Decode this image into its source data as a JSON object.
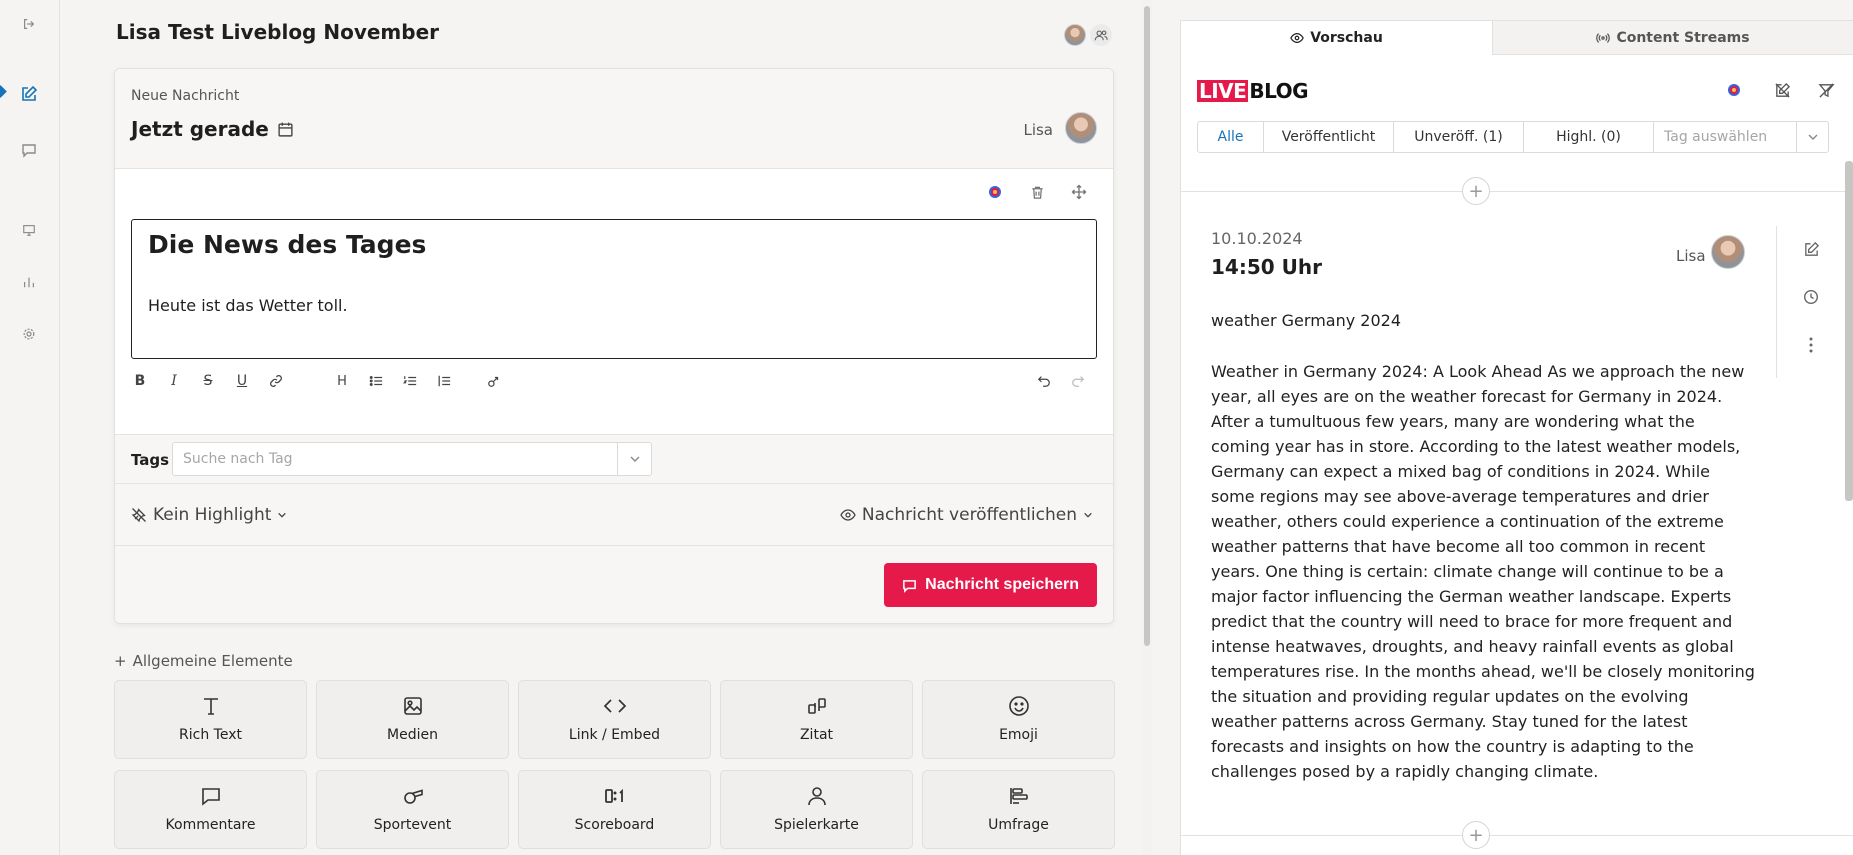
{
  "editor": {
    "title": "Lisa Test Liveblog November",
    "card": {
      "label": "Neue Nachricht",
      "time": "Jetzt gerade",
      "author": "Lisa",
      "headline": "Die News des Tages",
      "paragraph": "Heute ist das Wetter toll.",
      "tags_label": "Tags",
      "tags_placeholder": "Suche nach Tag",
      "highlight": "Kein Highlight",
      "publish": "Nachricht veröffentlichen",
      "save": "Nachricht speichern"
    },
    "elements_title": "Allgemeine Elemente",
    "elements": [
      {
        "label": "Rich Text",
        "icon": "text-icon"
      },
      {
        "label": "Medien",
        "icon": "image-icon"
      },
      {
        "label": "Link / Embed",
        "icon": "code-icon"
      },
      {
        "label": "Zitat",
        "icon": "quote-icon"
      },
      {
        "label": "Emoji",
        "icon": "smiley-icon"
      },
      {
        "label": "Kommentare",
        "icon": "comment-icon"
      },
      {
        "label": "Sportevent",
        "icon": "whistle-icon"
      },
      {
        "label": "Scoreboard",
        "icon": "scoreboard-icon"
      },
      {
        "label": "Spielerkarte",
        "icon": "person-icon"
      },
      {
        "label": "Umfrage",
        "icon": "poll-icon"
      }
    ]
  },
  "preview": {
    "tabs": [
      "Vorschau",
      "Content Streams"
    ],
    "logo_live": "LIVE",
    "logo_blog": "BLOG",
    "filters": [
      "Alle",
      "Veröffentlicht",
      "Unveröff. (1)",
      "Highl. (0)"
    ],
    "tag_placeholder": "Tag auswählen",
    "post": {
      "date": "10.10.2024",
      "time": "14:50 Uhr",
      "author": "Lisa",
      "headline": "weather Germany 2024",
      "body": "Weather in Germany 2024: A Look Ahead As we approach the new year, all eyes are on the weather forecast for Germany in 2024. After a tumultuous few years, many are wondering what the coming year has in store. According to the latest weather models, Germany can expect a mixed bag of conditions in 2024. While some regions may see above-average temperatures and drier weather, others could experience a continuation of the extreme weather patterns that have become all too common in recent years. One thing is certain: climate change will continue to be a major factor influencing the German weather landscape. Experts predict that the country will need to brace for more frequent and intense heatwaves, droughts, and heavy rainfall events as global temperatures rise. In the months ahead, we'll be closely monitoring the situation and providing regular updates on the evolving weather patterns across Germany. Stay tuned for the latest forecasts and insights on how the country is adapting to the challenges posed by a rapidly changing climate."
    }
  },
  "colors": {
    "accent": "#e5194a",
    "link": "#1a73b8"
  }
}
